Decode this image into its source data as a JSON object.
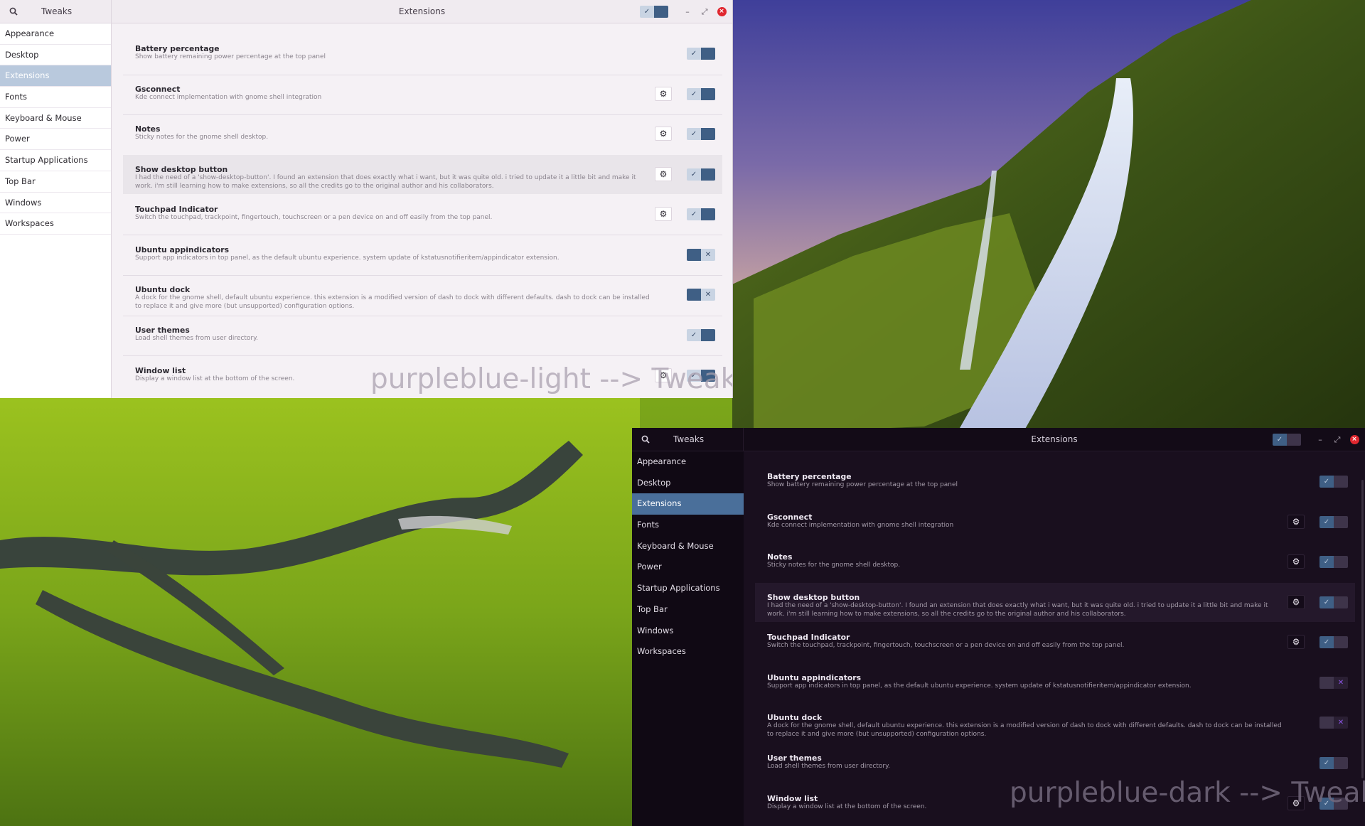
{
  "app_name": "Tweaks",
  "page_title": "Extensions",
  "sidebar": {
    "items": [
      {
        "label": "Appearance"
      },
      {
        "label": "Desktop"
      },
      {
        "label": "Extensions",
        "selected": true
      },
      {
        "label": "Fonts"
      },
      {
        "label": "Keyboard & Mouse"
      },
      {
        "label": "Power"
      },
      {
        "label": "Startup Applications"
      },
      {
        "label": "Top Bar"
      },
      {
        "label": "Windows"
      },
      {
        "label": "Workspaces"
      }
    ]
  },
  "extensions": [
    {
      "name": "Battery percentage",
      "description": "Show battery remaining power percentage at the top panel",
      "has_settings": false,
      "enabled": true
    },
    {
      "name": "Gsconnect",
      "description": "Kde connect implementation with gnome shell integration",
      "has_settings": true,
      "enabled": true
    },
    {
      "name": "Notes",
      "description": "Sticky notes for the gnome shell desktop.",
      "has_settings": true,
      "enabled": true
    },
    {
      "name": "Show desktop button",
      "description": "I had the need of a 'show-desktop-button'. I found an extension that does exactly what i want, but it was quite old. i tried to update it a little bit and make it work. i'm still learning how to make extensions, so all the credits go to the original author and his collaborators.",
      "has_settings": true,
      "enabled": true,
      "highlighted": true
    },
    {
      "name": "Touchpad Indicator",
      "description": "Switch the touchpad, trackpoint, fingertouch, touchscreen or a pen device on and off easily from the top panel.",
      "has_settings": true,
      "enabled": true
    },
    {
      "name": "Ubuntu appindicators",
      "description": "Support app indicators in top panel, as the default ubuntu experience. system update of kstatusnotifieritem/appindicator extension.",
      "has_settings": false,
      "enabled": false
    },
    {
      "name": "Ubuntu dock",
      "description": "A dock for the gnome shell, default ubuntu experience. this extension is a modified version of dash to dock with different defaults. dash to dock can be installed to replace it and give more (but unsupported) configuration options.",
      "has_settings": false,
      "enabled": false
    },
    {
      "name": "User themes",
      "description": "Load shell themes from user directory.",
      "has_settings": false,
      "enabled": true
    },
    {
      "name": "Window list",
      "description": "Display a window list at the bottom of the screen.",
      "has_settings": true,
      "enabled": true
    }
  ],
  "light_window": {
    "watermark": "purpleblue-light --> Tweak"
  },
  "dark_window": {
    "watermark": "purpleblue-dark --> Tweak"
  },
  "icons": {
    "search": "search-icon",
    "gear": "gear-icon",
    "check": "checkmark-icon",
    "cross": "cross-icon",
    "minimize": "minimize-icon",
    "restore": "restore-icon",
    "close": "close-icon"
  },
  "colors": {
    "accent_light": "#3f5f85",
    "accent_dark": "#4a6f9a",
    "close_button": "#e0272f",
    "off_cross_dark": "#8d55e8"
  },
  "wallpaper": {
    "scene": "waterfall-and-green-valley"
  }
}
